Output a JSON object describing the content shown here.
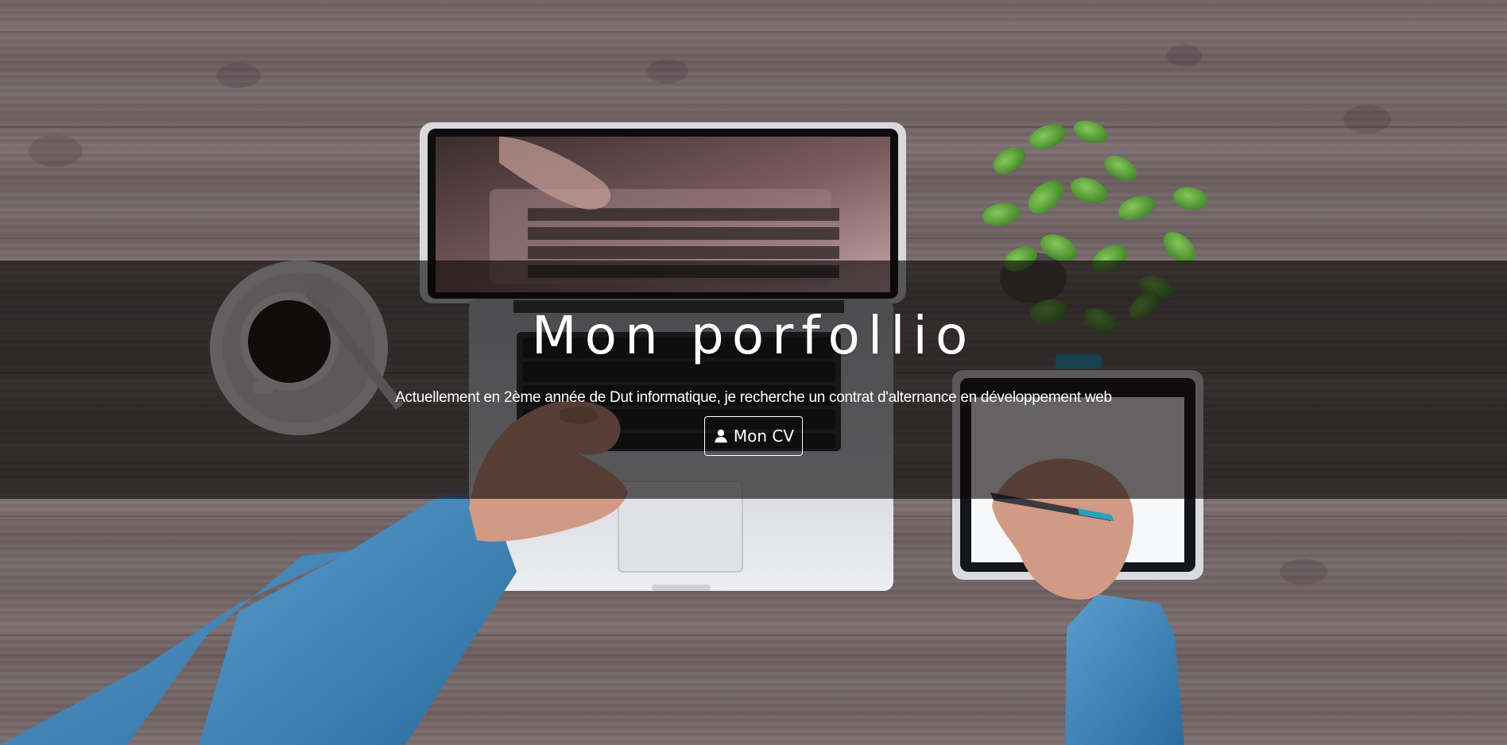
{
  "hero": {
    "title": "Mon porfollio",
    "subtitle": "Actuellement en 2ème année de Dut informatique, je recherche un contrat d'alternance en développement web",
    "cv_button": {
      "label": "Mon CV",
      "icon": "user-icon"
    }
  },
  "colors": {
    "overlay": "#0a0606",
    "text": "#ffffff",
    "wood": "#716466"
  }
}
